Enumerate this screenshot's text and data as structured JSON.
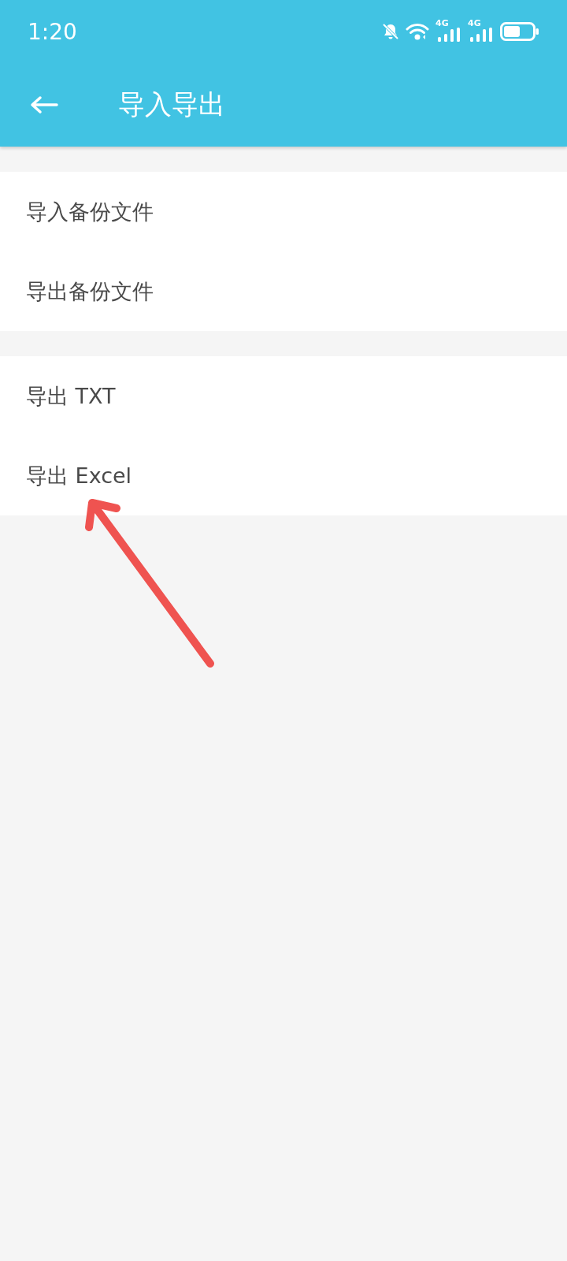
{
  "status_bar": {
    "time": "1:20",
    "network_labels": [
      "4G",
      "4G"
    ]
  },
  "app_bar": {
    "title": "导入导出"
  },
  "groups": [
    {
      "items": [
        "导入备份文件",
        "导出备份文件"
      ]
    },
    {
      "items": [
        "导出 TXT",
        "导出 Excel"
      ]
    }
  ]
}
